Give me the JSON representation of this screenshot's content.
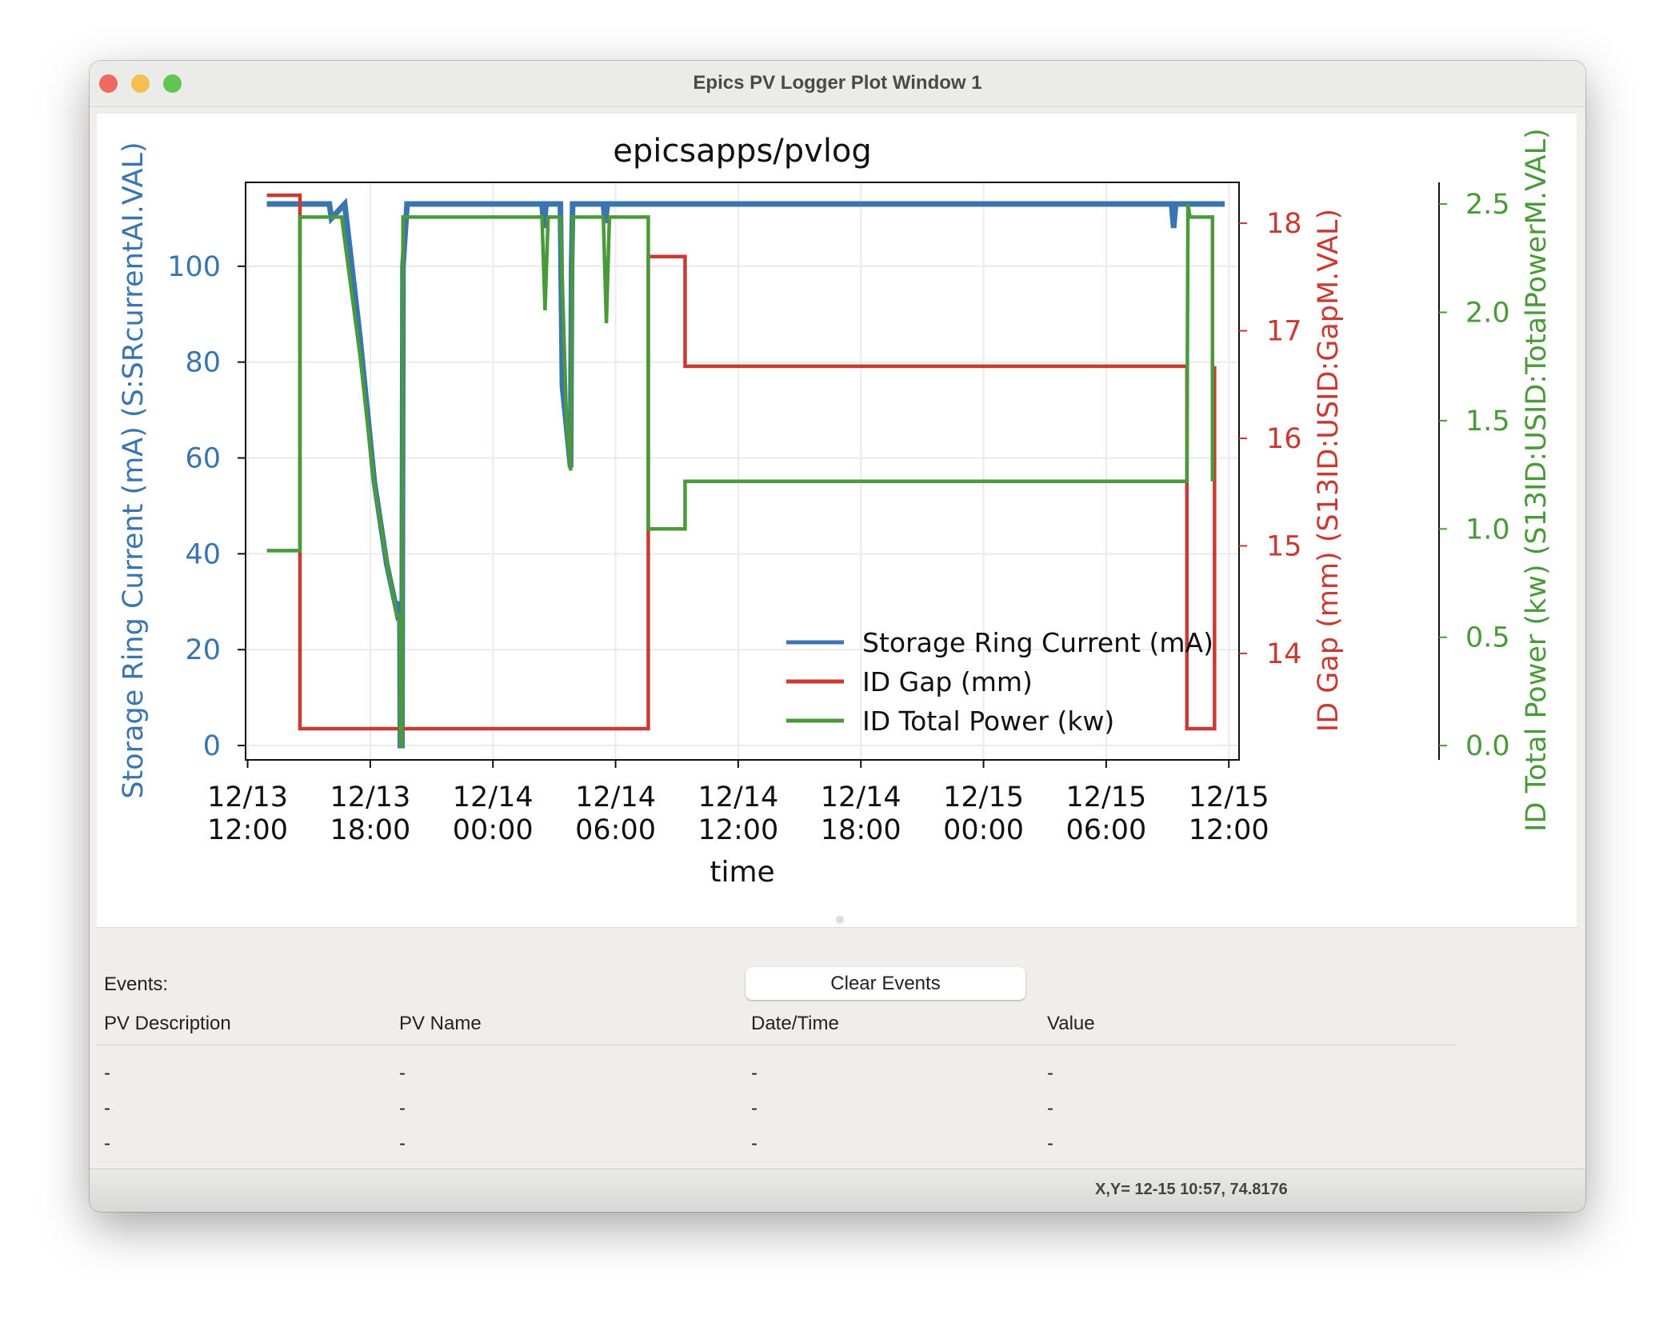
{
  "window": {
    "title": "Epics PV Logger Plot Window 1"
  },
  "chart_data": {
    "type": "line",
    "title": "epicsapps/pvlog",
    "xlabel": "time",
    "x_ticks": [
      "12/13\n12:00",
      "12/13\n18:00",
      "12/14\n00:00",
      "12/14\n06:00",
      "12/14\n12:00",
      "12/14\n18:00",
      "12/15\n00:00",
      "12/15\n06:00",
      "12/15\n12:00"
    ],
    "x_tick_hours": [
      0,
      6,
      12,
      18,
      24,
      30,
      36,
      42,
      48
    ],
    "x_unit_note": "x values are hours after 12/13 12:00",
    "xlim_hours": [
      -0.1,
      48.5
    ],
    "grid": true,
    "legend_position": "bottom-right",
    "axes": [
      {
        "side": "left",
        "label": "Storage Ring Current (mA) (S:SRcurrentAI.VAL)",
        "color": "#3a75b0",
        "ticks": [
          0,
          20,
          40,
          60,
          80,
          100
        ],
        "ylim": [
          -3,
          117.5
        ]
      },
      {
        "side": "right",
        "label": "ID Gap (mm) (S13ID:USID:GapM.VAL)",
        "color": "#c93a33",
        "ticks": [
          14,
          15,
          16,
          17,
          18
        ],
        "ylim": [
          13.01,
          18.38
        ]
      },
      {
        "side": "right-outer",
        "label": "ID Total Power (kw) (S13ID:USID:TotalPowerM.VAL)",
        "color": "#4a9a3a",
        "ticks": [
          "0.0",
          "0.5",
          "1.0",
          "1.5",
          "2.0",
          "2.5"
        ],
        "tick_values": [
          0,
          0.5,
          1,
          1.5,
          2,
          2.5
        ],
        "ylim": [
          -0.066,
          2.6
        ]
      }
    ],
    "series": [
      {
        "name": "Storage Ring Current (mA)",
        "axis": 0,
        "color": "#3a75b0",
        "x": [
          0.94,
          4.0,
          4.1,
          4.75,
          5.5,
          6.2,
          6.8,
          7.3,
          7.45,
          7.47,
          7.55,
          7.6,
          7.8,
          14.4,
          14.5,
          14.6,
          15.3,
          15.4,
          15.8,
          15.85,
          15.9,
          17.4,
          17.5,
          17.6,
          45.2,
          45.3,
          45.4,
          47.8
        ],
        "y": [
          113,
          113,
          110,
          113,
          85,
          55,
          38,
          28,
          30,
          0,
          0,
          100,
          113,
          113,
          108,
          113,
          113,
          75,
          58,
          100,
          113,
          113,
          109,
          113,
          113,
          108,
          113,
          113
        ]
      },
      {
        "name": "ID Gap (mm)",
        "axis": 1,
        "color": "#c93a33",
        "x": [
          0.94,
          2.56,
          2.56,
          19.6,
          19.6,
          21.4,
          21.4,
          45.95,
          45.95,
          47.3,
          47.3
        ],
        "y": [
          18.26,
          18.26,
          13.3,
          13.3,
          17.69,
          17.69,
          16.67,
          16.67,
          13.3,
          13.3,
          16.67
        ]
      },
      {
        "name": "ID Total Power (kw)",
        "axis": 2,
        "color": "#4a9a3a",
        "x": [
          0.94,
          2.56,
          2.56,
          4.6,
          5.5,
          6.2,
          6.8,
          7.3,
          7.45,
          7.47,
          7.55,
          7.6,
          14.4,
          14.55,
          14.7,
          15.3,
          15.6,
          15.8,
          15.9,
          17.4,
          17.55,
          17.7,
          19.6,
          19.6,
          21.4,
          21.4,
          45.95,
          46.0,
          46.1,
          47.2,
          47.2
        ],
        "y": [
          0.9,
          0.9,
          2.44,
          2.44,
          1.8,
          1.2,
          0.85,
          0.6,
          0.6,
          0,
          0,
          2.44,
          2.44,
          2.01,
          2.44,
          2.44,
          1.5,
          1.27,
          2.44,
          2.44,
          1.95,
          2.44,
          2.44,
          1.0,
          1.0,
          1.22,
          1.22,
          2.5,
          2.44,
          2.44,
          1.22
        ]
      }
    ]
  },
  "events": {
    "label": "Events:",
    "clear_button": "Clear Events",
    "columns": [
      "PV Description",
      "PV Name",
      "Date/Time",
      "Value"
    ],
    "rows": [
      [
        "-",
        "-",
        "-",
        "-"
      ],
      [
        "-",
        "-",
        "-",
        "-"
      ],
      [
        "-",
        "-",
        "-",
        "-"
      ]
    ]
  },
  "status": {
    "cursor_readout": "X,Y= 12-15 10:57, 74.8176"
  },
  "colors": {
    "close": "#ed6a5e",
    "minimize": "#f5bf4f",
    "zoom": "#61c554"
  }
}
